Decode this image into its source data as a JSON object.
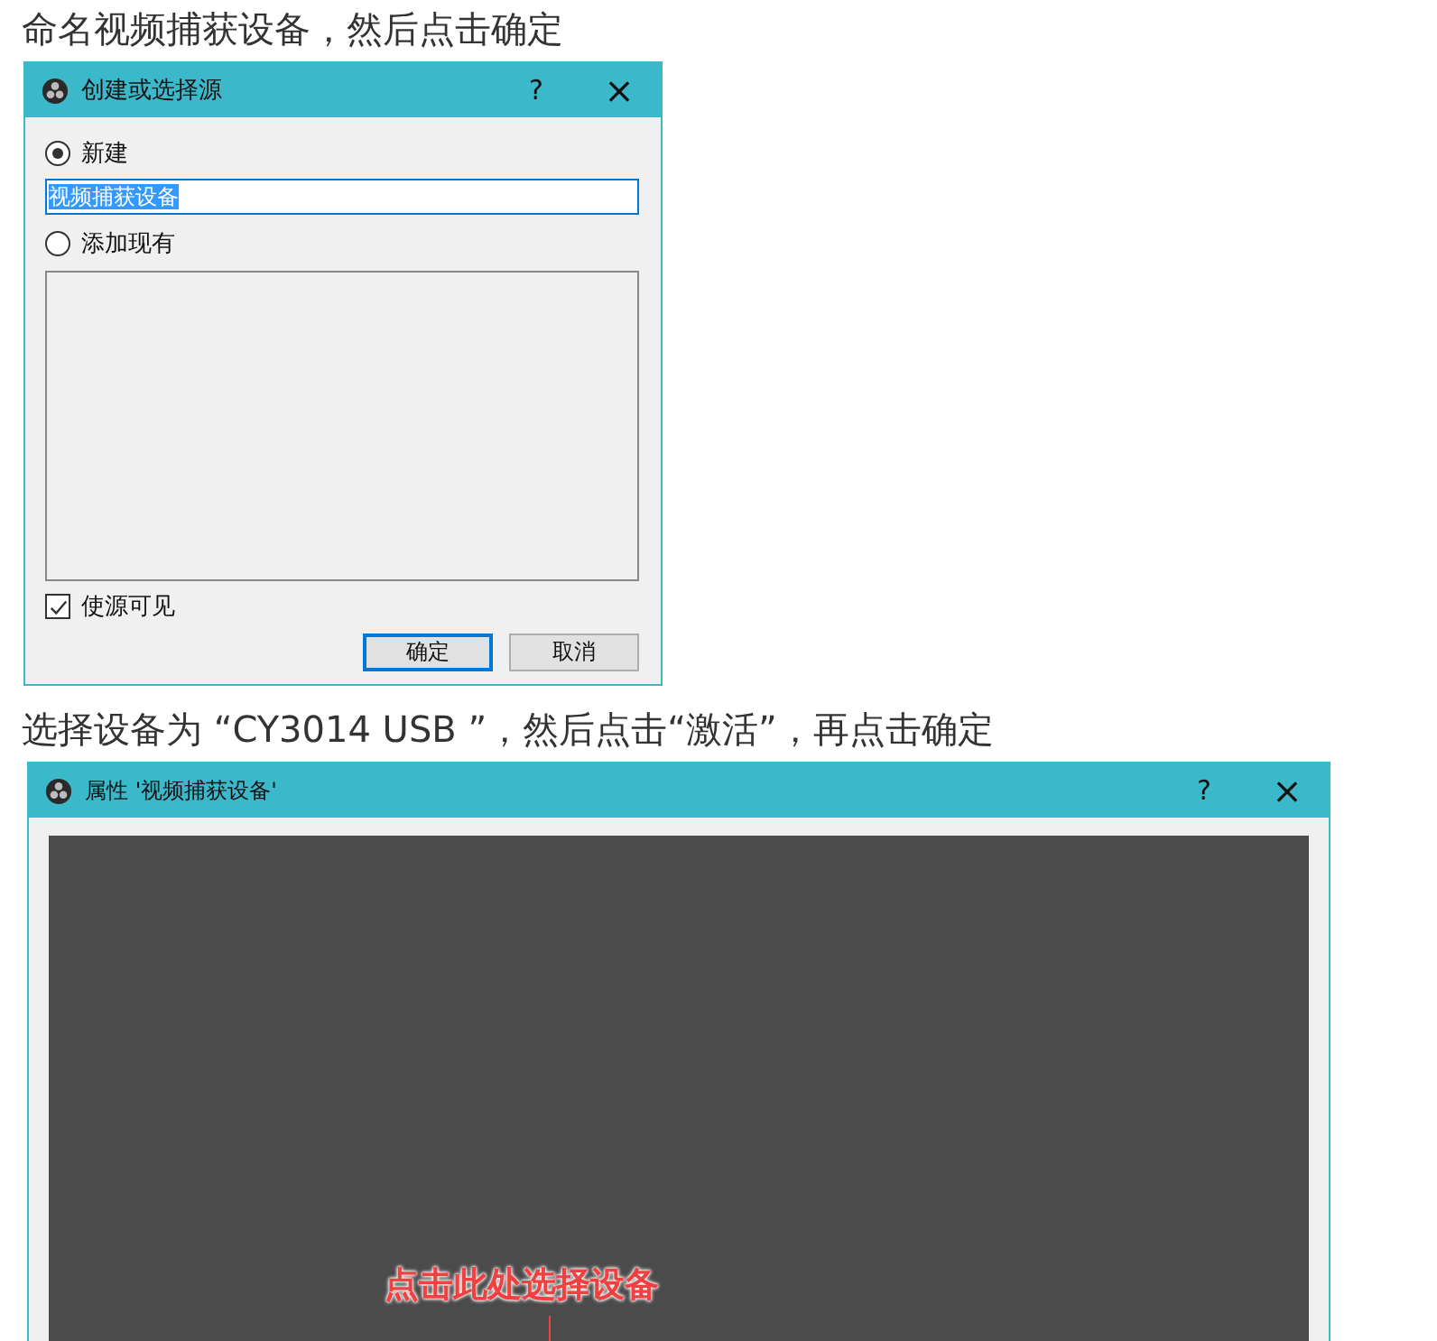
{
  "caption_1": "命名视频捕获设备，然后点击确定",
  "create_dialog": {
    "title": "创建或选择源",
    "help": "?",
    "close": "×",
    "options": [
      {
        "label": "新建",
        "selected": true
      },
      {
        "label": "添加现有",
        "selected": false
      }
    ],
    "name_field": {
      "value": "视频捕获设备",
      "highlighted": true
    },
    "visible_checkbox": {
      "label": "使源可见",
      "checked": true
    },
    "buttons": [
      {
        "label": "确定",
        "default": true
      },
      {
        "label": "取消",
        "default": false
      }
    ]
  },
  "caption_2": "选择设备为 “CY3014 USB ”，然后点击“激活”，再点击确定",
  "properties_dialog": {
    "title": "属性 '视频捕获设备'",
    "help": "?",
    "close": "×",
    "annotation": "点击此处选择设备"
  }
}
